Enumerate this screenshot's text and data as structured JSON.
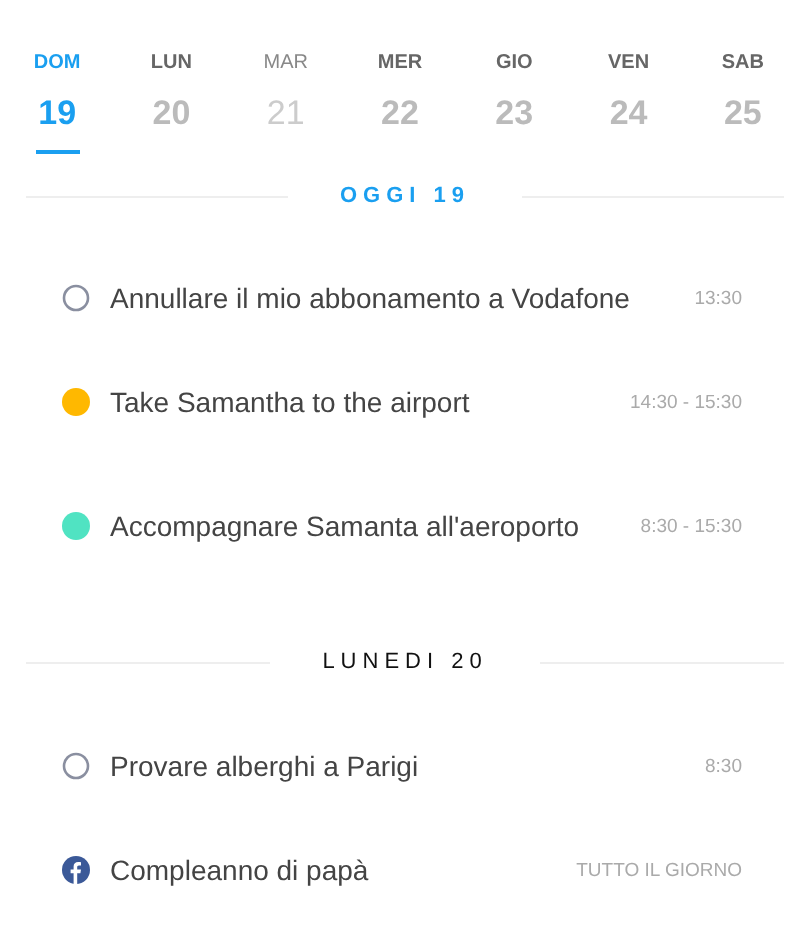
{
  "days": [
    {
      "label": "DOM",
      "number": "19",
      "selected": true,
      "dimmed": false
    },
    {
      "label": "LUN",
      "number": "20",
      "selected": false,
      "dimmed": false
    },
    {
      "label": "MAR",
      "number": "21",
      "selected": false,
      "dimmed": true
    },
    {
      "label": "MER",
      "number": "22",
      "selected": false,
      "dimmed": false
    },
    {
      "label": "GIO",
      "number": "23",
      "selected": false,
      "dimmed": false
    },
    {
      "label": "VEN",
      "number": "24",
      "selected": false,
      "dimmed": false
    },
    {
      "label": "SAB",
      "number": "25",
      "selected": false,
      "dimmed": false
    }
  ],
  "sections": [
    {
      "title": "OGGI 19",
      "highlighted": true,
      "events": [
        {
          "kind": "task",
          "title": "Annullare il mio abbonamento a Vodafone",
          "time": "13:30"
        },
        {
          "kind": "event",
          "color": "#ffb800",
          "title": "Take Samantha to the airport",
          "time": "14:30 - 15:30"
        },
        {
          "kind": "event",
          "color": "#50e3c2",
          "title": "Accompagnare Samanta all'aeroporto",
          "time": "8:30 - 15:30"
        }
      ]
    },
    {
      "title": "LUNEDI 20",
      "highlighted": false,
      "events": [
        {
          "kind": "task",
          "title": "Provare alberghi a Parigi",
          "time": "8:30"
        },
        {
          "kind": "facebook",
          "title": "Compleanno di papà",
          "time": "TUTTO IL GIORNO"
        }
      ]
    }
  ]
}
